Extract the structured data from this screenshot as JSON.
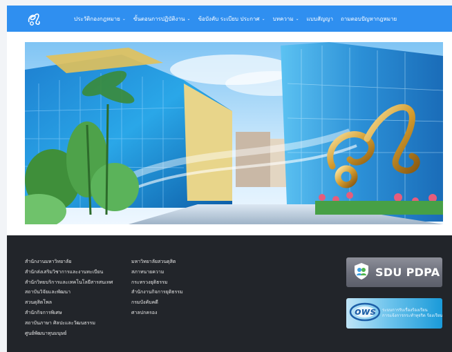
{
  "header": {
    "logo_icon": "university-monogram-logo-icon",
    "nav": [
      {
        "label": "ประวัติกองกฎหมาย",
        "has_dropdown": true
      },
      {
        "label": "ขั้นตอนการปฏิบัติงาน",
        "has_dropdown": true
      },
      {
        "label": "ข้อบังคับ ระเบียบ ประกาศ",
        "has_dropdown": true
      },
      {
        "label": "บทความ",
        "has_dropdown": true
      },
      {
        "label": "แบบสัญญา",
        "has_dropdown": false
      },
      {
        "label": "ถามตอบปัญหากฎหมาย",
        "has_dropdown": false
      }
    ],
    "dropdown_icon": "chevron-down-icon"
  },
  "hero": {
    "image": "campus-buildings-with-gold-monogram-photo"
  },
  "footer": {
    "links_col1": [
      "สำนักงานมหาวิทยาลัย",
      "สำนักส่งเสริมวิชาการและงานทะเบียน",
      "สำนักวิทยบริการและเทคโนโลยีสารสนเทศ",
      "สถาบันวิจัยและพัฒนา",
      "สวนดุสิตโพล",
      "สำนักกิจการพิเศษ",
      "สถาบันภาษา ศิลปะและวัฒนธรรม",
      "ศูนย์พัฒนาทุนมนุษย์"
    ],
    "links_col2": [
      "มหาวิทยาลัยสวนดุสิต",
      "สภาทนายความ",
      "กระทรวงยุติธรรม",
      "สำนักงานกิจการยุติธรรม",
      "กรมบังคับคดี",
      "ศาลปกครอง"
    ],
    "badges": {
      "pdpa_label": "SDU PDPA",
      "pdpa_icon": "shield-people-icon",
      "ows_label": "ows",
      "ows_sub_line1": "ระบบการรับเรื่องร้องเรียน",
      "ows_sub_line2": "การแจ้งการกระทำทุจริต ร้องเรียน"
    }
  },
  "colors": {
    "header_bg": "#2f8ff0",
    "footer_bg": "#22252a",
    "page_bg": "#f2f4f7"
  }
}
